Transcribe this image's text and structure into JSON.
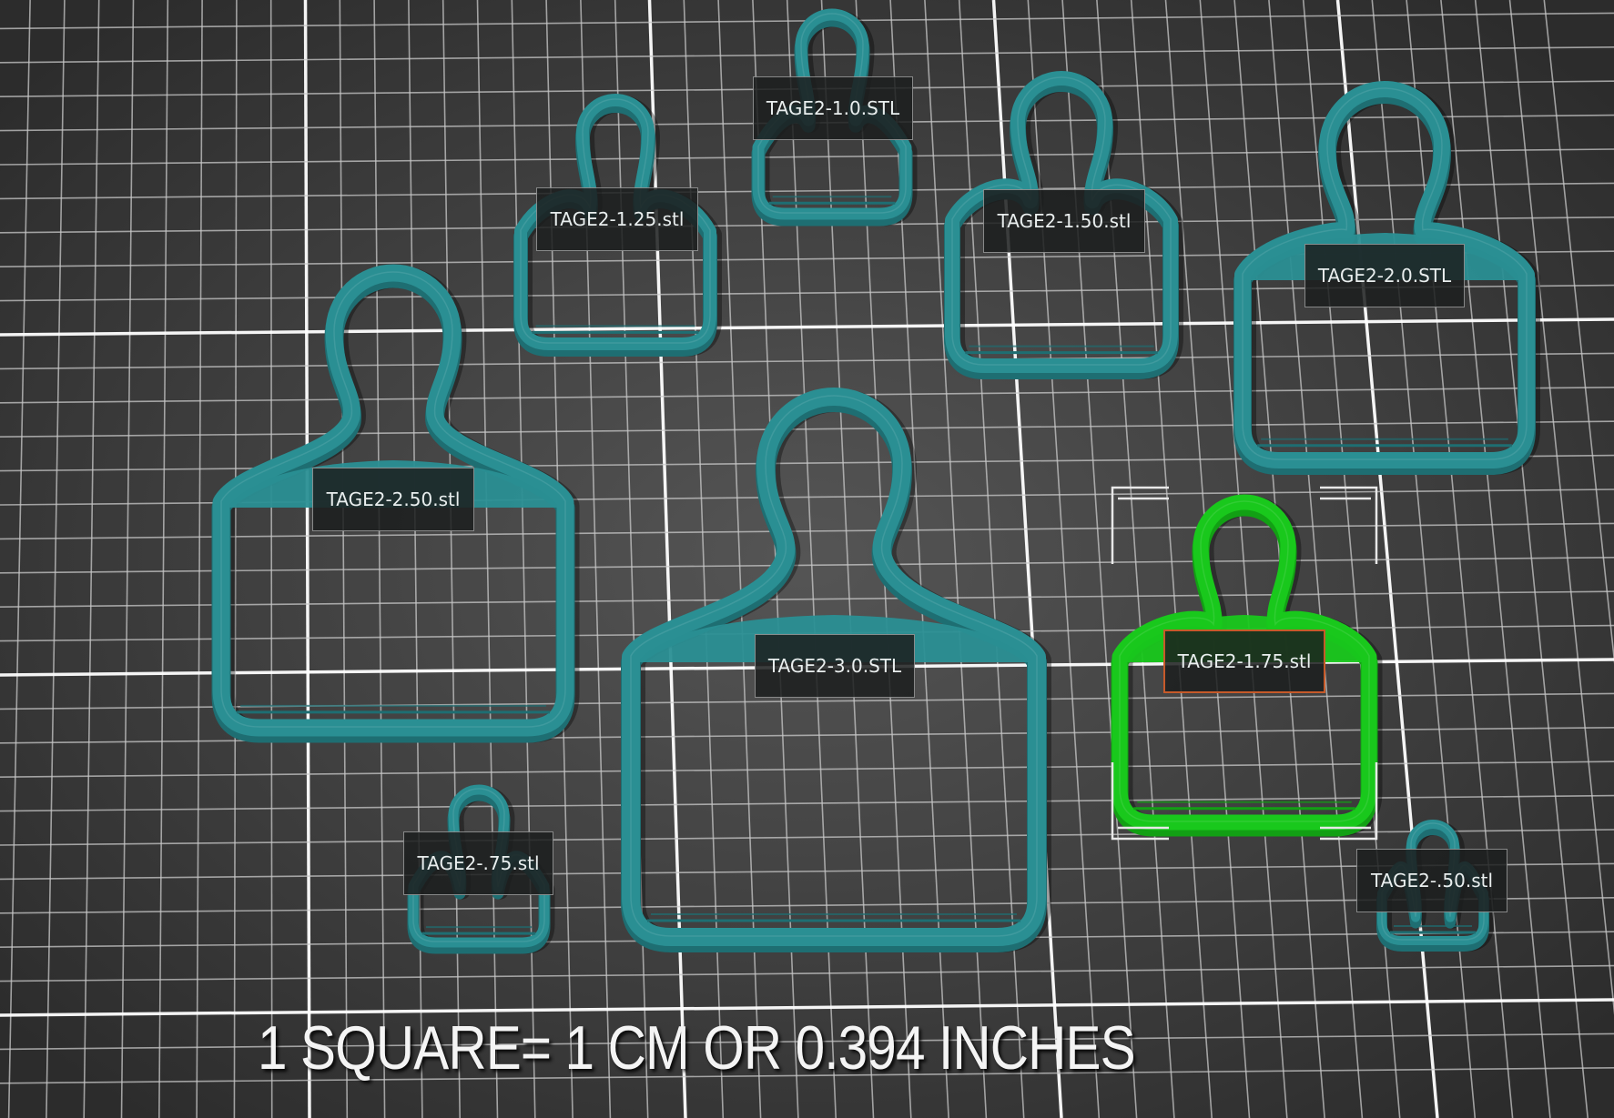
{
  "viewport": {
    "background": "#3a3a3a",
    "grid_minor_color": "#c8c8c8",
    "grid_major_color": "#ffffff"
  },
  "colors": {
    "cutter_fill": "#2a8f93",
    "cutter_edge": "#1e6e72",
    "selected_fill": "#19c81c",
    "selected_edge": "#12a014",
    "selection_label_border": "#c65a2a",
    "selection_bracket": "#e8e8e8"
  },
  "objects": [
    {
      "id": "tage2-1.0",
      "label": "TAGE2-1.0.STL",
      "selected": false
    },
    {
      "id": "tage2-1.25",
      "label": "TAGE2-1.25.stl",
      "selected": false
    },
    {
      "id": "tage2-1.50",
      "label": "TAGE2-1.50.stl",
      "selected": false
    },
    {
      "id": "tage2-2.0",
      "label": "TAGE2-2.0.STL",
      "selected": false
    },
    {
      "id": "tage2-2.50",
      "label": "TAGE2-2.50.stl",
      "selected": false
    },
    {
      "id": "tage2-3.0",
      "label": "TAGE2-3.0.STL",
      "selected": false
    },
    {
      "id": "tage2-1.75",
      "label": "TAGE2-1.75.stl",
      "selected": true
    },
    {
      "id": "tage2-.75",
      "label": "TAGE2-.75.stl",
      "selected": false
    },
    {
      "id": "tage2-.50",
      "label": "TAGE2-.50.stl",
      "selected": false
    }
  ],
  "scale_note": "1 SQUARE= 1 CM OR 0.394 INCHES"
}
